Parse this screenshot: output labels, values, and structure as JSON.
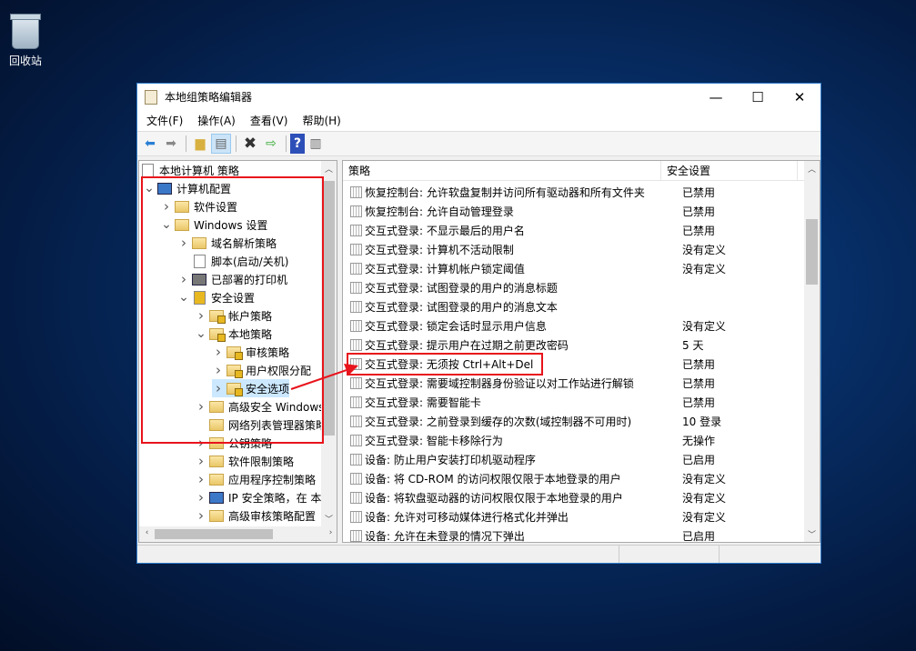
{
  "desktop": {
    "recycle_bin_label": "回收站"
  },
  "window": {
    "title": "本地组策略编辑器",
    "minimize": "—",
    "maximize": "☐",
    "close": "✕"
  },
  "menu": [
    "文件(F)",
    "操作(A)",
    "查看(V)",
    "帮助(H)"
  ],
  "toolbar": [
    "back-icon",
    "forward-icon",
    "up-folder-icon",
    "show-hide-tree-icon",
    "delete-icon",
    "export-list-icon",
    "help-icon",
    "properties-icon"
  ],
  "tree": {
    "root": "本地计算机 策略",
    "items": [
      {
        "label": "计算机配置",
        "level": 0,
        "chev": "v",
        "icon": "pc"
      },
      {
        "label": "软件设置",
        "level": 1,
        "chev": ">",
        "icon": "folder"
      },
      {
        "label": "Windows 设置",
        "level": 1,
        "chev": "v",
        "icon": "folder"
      },
      {
        "label": "域名解析策略",
        "level": 2,
        "chev": ">",
        "icon": "folder"
      },
      {
        "label": "脚本(启动/关机)",
        "level": 2,
        "chev": "",
        "icon": "doc"
      },
      {
        "label": "已部署的打印机",
        "level": 2,
        "chev": ">",
        "icon": "printer"
      },
      {
        "label": "安全设置",
        "level": 2,
        "chev": "v",
        "icon": "lockdoc"
      },
      {
        "label": "帐户策略",
        "level": 3,
        "chev": ">",
        "icon": "lockfolder"
      },
      {
        "label": "本地策略",
        "level": 3,
        "chev": "v",
        "icon": "lockfolder"
      },
      {
        "label": "审核策略",
        "level": 4,
        "chev": ">",
        "icon": "lockfolder"
      },
      {
        "label": "用户权限分配",
        "level": 4,
        "chev": ">",
        "icon": "lockfolder"
      },
      {
        "label": "安全选项",
        "level": 4,
        "chev": ">",
        "icon": "lockfolder",
        "selected": true
      },
      {
        "label": "高级安全 Windows",
        "level": 3,
        "chev": ">",
        "icon": "folder"
      },
      {
        "label": "网络列表管理器策略",
        "level": 3,
        "chev": "",
        "icon": "folder"
      },
      {
        "label": "公钥策略",
        "level": 3,
        "chev": ">",
        "icon": "folder"
      },
      {
        "label": "软件限制策略",
        "level": 3,
        "chev": ">",
        "icon": "folder"
      },
      {
        "label": "应用程序控制策略",
        "level": 3,
        "chev": ">",
        "icon": "folder"
      },
      {
        "label": "IP 安全策略，在 本",
        "level": 3,
        "chev": ">",
        "icon": "pc"
      },
      {
        "label": "高级审核策略配置",
        "level": 3,
        "chev": ">",
        "icon": "folder"
      }
    ]
  },
  "list": {
    "columns": [
      "策略",
      "安全设置"
    ],
    "rows": [
      {
        "policy": "恢复控制台: 允许软盘复制并访问所有驱动器和所有文件夹",
        "setting": "已禁用"
      },
      {
        "policy": "恢复控制台: 允许自动管理登录",
        "setting": "已禁用"
      },
      {
        "policy": "交互式登录: 不显示最后的用户名",
        "setting": "已禁用"
      },
      {
        "policy": "交互式登录: 计算机不活动限制",
        "setting": "没有定义"
      },
      {
        "policy": "交互式登录: 计算机帐户锁定阈值",
        "setting": "没有定义"
      },
      {
        "policy": "交互式登录: 试图登录的用户的消息标题",
        "setting": ""
      },
      {
        "policy": "交互式登录: 试图登录的用户的消息文本",
        "setting": ""
      },
      {
        "policy": "交互式登录: 锁定会话时显示用户信息",
        "setting": "没有定义"
      },
      {
        "policy": "交互式登录: 提示用户在过期之前更改密码",
        "setting": "5 天"
      },
      {
        "policy": "交互式登录: 无须按 Ctrl+Alt+Del",
        "setting": "已禁用"
      },
      {
        "policy": "交互式登录: 需要域控制器身份验证以对工作站进行解锁",
        "setting": "已禁用"
      },
      {
        "policy": "交互式登录: 需要智能卡",
        "setting": "已禁用"
      },
      {
        "policy": "交互式登录: 之前登录到缓存的次数(域控制器不可用时)",
        "setting": "10 登录"
      },
      {
        "policy": "交互式登录: 智能卡移除行为",
        "setting": "无操作"
      },
      {
        "policy": "设备: 防止用户安装打印机驱动程序",
        "setting": "已启用"
      },
      {
        "policy": "设备: 将 CD-ROM 的访问权限仅限于本地登录的用户",
        "setting": "没有定义"
      },
      {
        "policy": "设备: 将软盘驱动器的访问权限仅限于本地登录的用户",
        "setting": "没有定义"
      },
      {
        "policy": "设备: 允许对可移动媒体进行格式化并弹出",
        "setting": "没有定义"
      },
      {
        "policy": "设备: 允许在未登录的情况下弹出",
        "setting": "已启用"
      }
    ]
  },
  "annotation_color": "#e8131b"
}
